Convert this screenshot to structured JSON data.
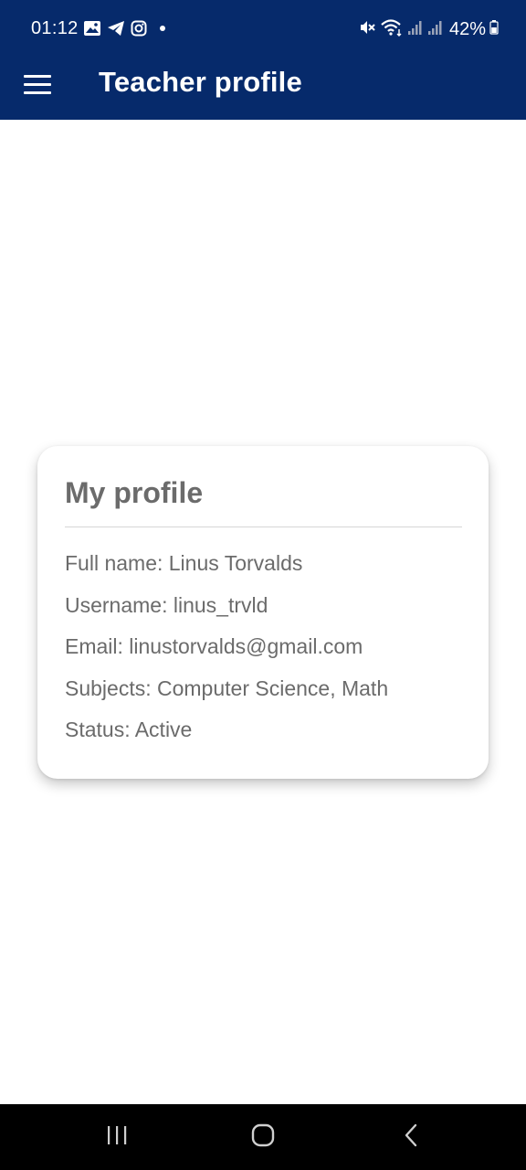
{
  "status_bar": {
    "time": "01:12",
    "battery": "42%",
    "left_icons": [
      "gallery-icon",
      "telegram-icon",
      "instagram-icon",
      "notification-dot"
    ],
    "right_icons": [
      "mute-icon",
      "wifi-icon",
      "signal-icon",
      "signal-icon"
    ]
  },
  "app_bar": {
    "title": "Teacher profile",
    "menu_icon": "hamburger-menu-icon",
    "background": "#062a6b"
  },
  "profile_card": {
    "title": "My profile",
    "fields": [
      "Full name: Linus Torvalds",
      "Username: linus_trvld",
      "Email: linustorvalds@gmail.com",
      "Subjects: Computer Science, Math",
      "Status: Active"
    ]
  },
  "nav_bar": {
    "buttons": [
      "recents-icon",
      "home-icon",
      "back-icon"
    ]
  }
}
